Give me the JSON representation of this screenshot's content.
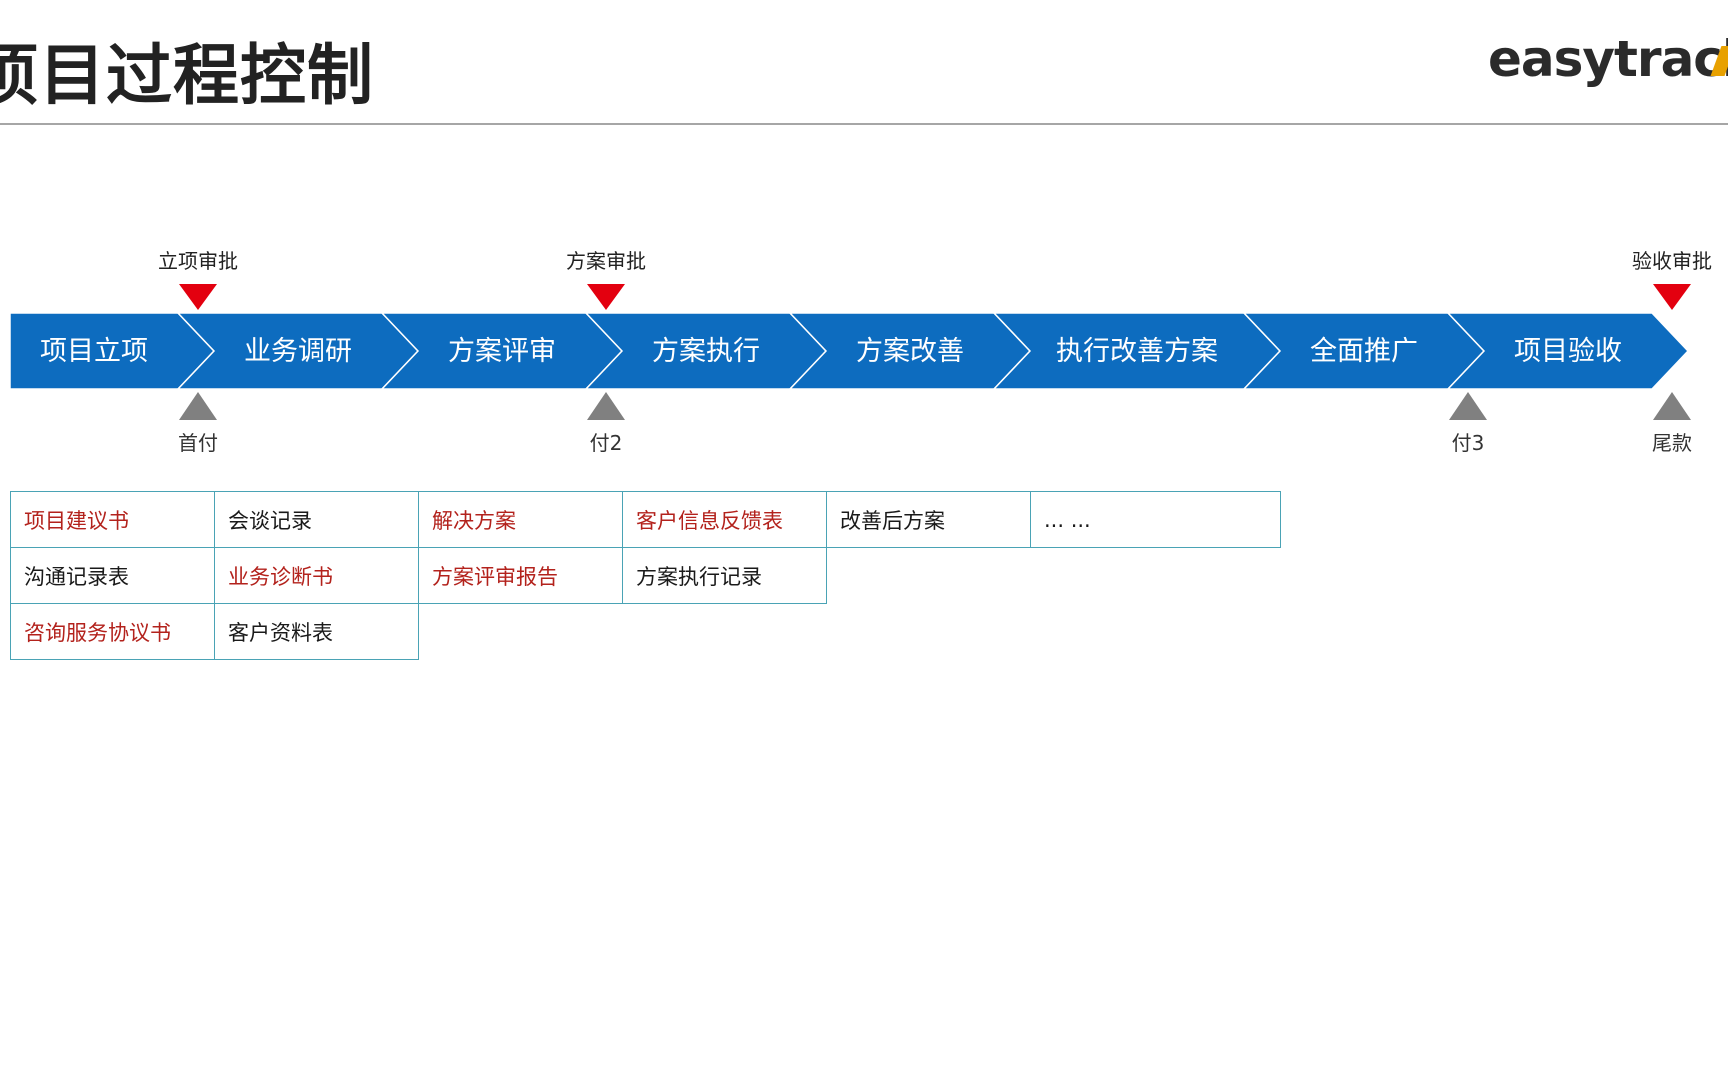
{
  "header": {
    "title": "项目过程控制",
    "logo_text": "easytrack"
  },
  "colors": {
    "chevron_fill": "#0d6cbf",
    "approval_marker": "#e3000f",
    "payment_marker": "#808080",
    "table_border": "#4aa3b5",
    "highlight_text": "#b3221c"
  },
  "stages": [
    "项目立项",
    "业务调研",
    "方案评审",
    "方案执行",
    "方案改善",
    "执行改善方案",
    "全面推广",
    "项目验收"
  ],
  "approvals": [
    {
      "label": "立项审批",
      "after_stage": 1
    },
    {
      "label": "方案审批",
      "after_stage": 3
    },
    {
      "label": "验收审批",
      "after_stage": 8
    }
  ],
  "payments": [
    {
      "label": "首付",
      "after_stage": 1
    },
    {
      "label": "付2",
      "after_stage": 3
    },
    {
      "label": "付3",
      "after_stage": 7
    },
    {
      "label": "尾款",
      "after_stage": 8
    }
  ],
  "documents": {
    "rows": [
      [
        {
          "text": "项目建议书",
          "highlight": true
        },
        {
          "text": "会谈记录",
          "highlight": false
        },
        {
          "text": "解决方案",
          "highlight": true
        },
        {
          "text": "客户信息反馈表",
          "highlight": true
        },
        {
          "text": "改善后方案",
          "highlight": false
        },
        {
          "text": "... ...",
          "highlight": false
        }
      ],
      [
        {
          "text": "沟通记录表",
          "highlight": false
        },
        {
          "text": "业务诊断书",
          "highlight": true
        },
        {
          "text": "方案评审报告",
          "highlight": true
        },
        {
          "text": "方案执行记录",
          "highlight": false
        }
      ],
      [
        {
          "text": "咨询服务协议书",
          "highlight": true
        },
        {
          "text": "客户资料表",
          "highlight": false
        }
      ]
    ]
  }
}
